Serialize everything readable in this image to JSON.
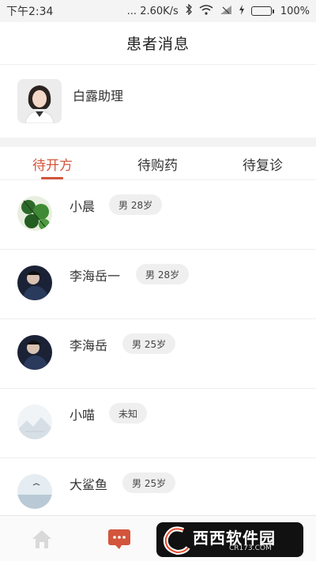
{
  "status_bar": {
    "time": "下午2:34",
    "network_speed": "... 2.60K/s",
    "battery_text": "100%",
    "battery_level": 1.0,
    "icons": [
      "bluetooth-icon",
      "wifi-icon",
      "no-sim-icon",
      "charging-icon",
      "battery-icon"
    ]
  },
  "header": {
    "title": "患者消息"
  },
  "assistant": {
    "name": "白露助理",
    "avatar_icon": "assistant-photo"
  },
  "tabs": [
    {
      "label": "待开方",
      "active": true
    },
    {
      "label": "待购药",
      "active": false
    },
    {
      "label": "待复诊",
      "active": false
    }
  ],
  "patients": [
    {
      "name": "小晨",
      "info": "男 28岁",
      "avatar": "leaf-photo"
    },
    {
      "name": "李海岳一",
      "info": "男 28岁",
      "avatar": "dark-portrait-photo"
    },
    {
      "name": "李海岳",
      "info": "男 25岁",
      "avatar": "dark-portrait-photo"
    },
    {
      "name": "小喵",
      "info": "未知",
      "avatar": "mountain-illustration"
    },
    {
      "name": "大鲨鱼",
      "info": "男 25岁",
      "avatar": "sea-photo"
    }
  ],
  "bottom_nav": {
    "items": [
      "home-icon",
      "message-icon"
    ],
    "accent": "#d2553c"
  },
  "watermark": {
    "title": "西西软件园",
    "subtitle": "CR173.COM"
  },
  "colors": {
    "accent": "#d2553c",
    "badge_bg": "#efefef"
  }
}
